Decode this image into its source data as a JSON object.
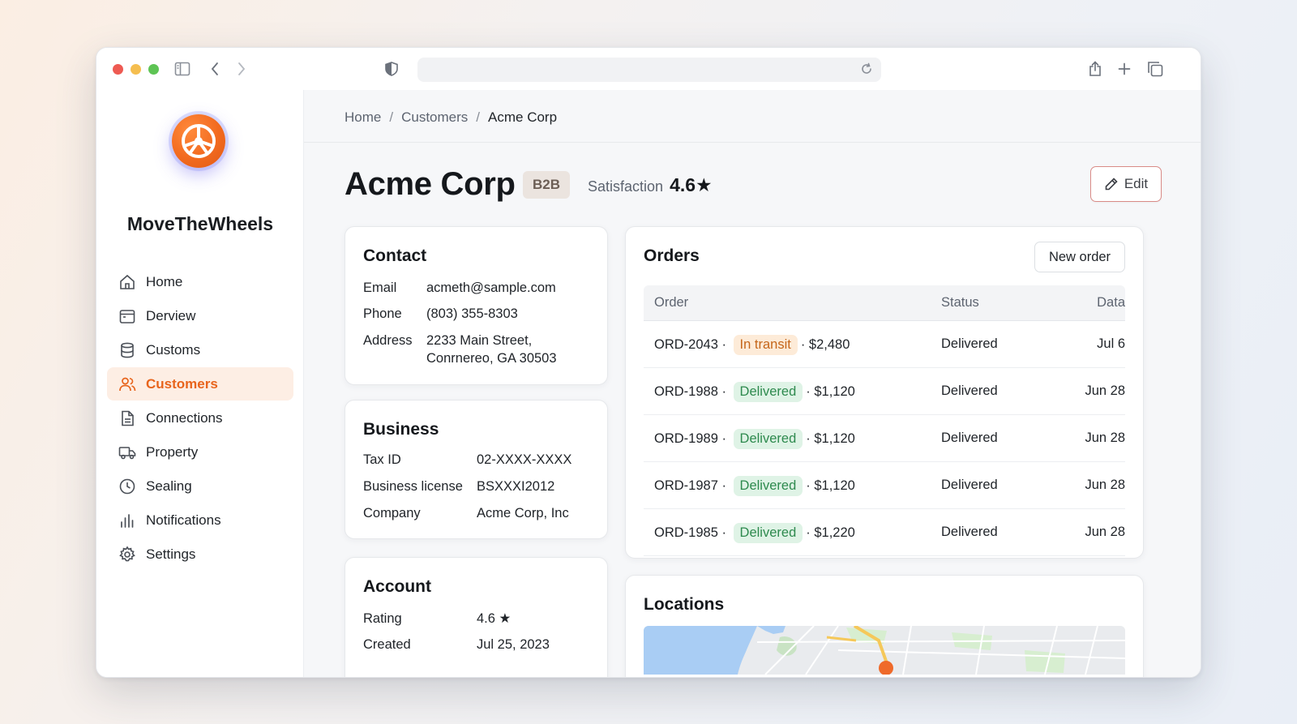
{
  "window": {
    "traffic_lights": {
      "close": "#ee5a52",
      "minimize": "#f5be4f",
      "maximize": "#5ec454"
    }
  },
  "toolbar": {
    "icons": [
      "sidebar-icon",
      "back-icon",
      "forward-icon",
      "shield-icon",
      "reload-icon",
      "share-icon",
      "new-tab-icon",
      "tabs-icon"
    ],
    "url": ""
  },
  "sidebar": {
    "brand": "MoveTheWheels",
    "accent": "#e8641c",
    "items": [
      {
        "label": "Home",
        "icon": "home-icon",
        "active": false
      },
      {
        "label": "Derview",
        "icon": "calendar-icon",
        "active": false
      },
      {
        "label": "Customs",
        "icon": "database-icon",
        "active": false
      },
      {
        "label": "Customers",
        "icon": "users-icon",
        "active": true
      },
      {
        "label": "Connections",
        "icon": "document-icon",
        "active": false
      },
      {
        "label": "Property",
        "icon": "truck-icon",
        "active": false
      },
      {
        "label": "Sealing",
        "icon": "clock-icon",
        "active": false
      },
      {
        "label": "Notifications",
        "icon": "bars-icon",
        "active": false
      },
      {
        "label": "Settings",
        "icon": "gear-icon",
        "active": false
      }
    ]
  },
  "breadcrumb": {
    "items": [
      "Home",
      "Customers",
      "Acme Corp"
    ],
    "separator": "/"
  },
  "header": {
    "title": "Acme Corp",
    "badge": "B2B",
    "satisfaction_label": "Satisfaction",
    "satisfaction_value": "4.6",
    "star": "★",
    "edit_label": "Edit"
  },
  "contact": {
    "title": "Contact",
    "email_label": "Email",
    "email": "acmeth@sample.com",
    "phone_label": "Phone",
    "phone": "(803) 355-8303",
    "address_label": "Address",
    "address_line1": "2233 Main Street,",
    "address_line2": "Conrnereo, GA 30503"
  },
  "business": {
    "title": "Business",
    "tax_label": "Tax ID",
    "tax": "02-XXXX-XXXX",
    "license_label": "Business license",
    "license": "BSXXXI2012",
    "company_label": "Company",
    "company": "Acme Corp, Inc"
  },
  "account": {
    "title": "Account",
    "rating_label": "Rating",
    "rating": "4.6",
    "created_label": "Created",
    "created": "Jul 25, 2023"
  },
  "orders": {
    "title": "Orders",
    "new_label": "New order",
    "columns": {
      "order": "Order",
      "status": "Status",
      "date": "Data"
    },
    "rows": [
      {
        "id": "ORD-2043",
        "pill": "In transit",
        "pill_type": "transit",
        "amount": "$2,480",
        "status": "Delivered",
        "date": "Jul 6"
      },
      {
        "id": "ORD-1988",
        "pill": "Delivered",
        "pill_type": "delivered",
        "amount": "$1,120",
        "status": "Delivered",
        "date": "Jun 28"
      },
      {
        "id": "ORD-1989",
        "pill": "Delivered",
        "pill_type": "delivered",
        "amount": "$1,120",
        "status": "Delivered",
        "date": "Jun 28"
      },
      {
        "id": "ORD-1987",
        "pill": "Delivered",
        "pill_type": "delivered",
        "amount": "$1,120",
        "status": "Delivered",
        "date": "Jun 28"
      },
      {
        "id": "ORD-1985",
        "pill": "Delivered",
        "pill_type": "delivered",
        "amount": "$1,220",
        "status": "Delivered",
        "date": "Jun 28"
      }
    ]
  },
  "locations": {
    "title": "Locations"
  }
}
